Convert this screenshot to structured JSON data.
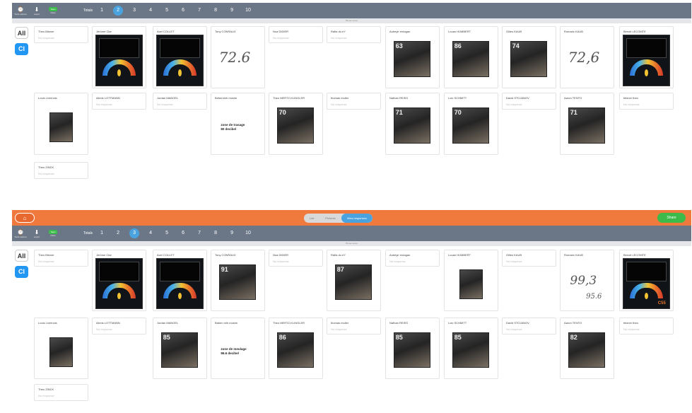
{
  "sidebar": {
    "all_label": "All",
    "cl_label": "Cl"
  },
  "toolbar": {
    "tools": [
      {
        "icon": "⌚",
        "label": "Tools options"
      },
      {
        "icon": "⬇",
        "label": "export"
      },
      {
        "badge": "Team",
        "label": "share"
      }
    ],
    "totals_label": "Totals",
    "pages": [
      "1",
      "2",
      "3",
      "4",
      "5",
      "6",
      "7",
      "8",
      "9",
      "10"
    ]
  },
  "panel1": {
    "active_page": "2",
    "substrip": "59 sec score",
    "cards": [
      {
        "name": "Theo Bitzner",
        "resp": "No response"
      },
      {
        "name": "Jérôme Clar"
      },
      {
        "name": "Axel COLLET"
      },
      {
        "name": "Tony CONRAUX",
        "hand": "72.6"
      },
      {
        "name": "Noa DIDIER",
        "resp": "No response"
      },
      {
        "name": "Rafia du eY",
        "resp": "No response"
      },
      {
        "name": "Aubeyir erdogan",
        "photo": "63"
      },
      {
        "name": "Louan HUMBERT",
        "photo": "86"
      },
      {
        "name": "Gilles KAUB",
        "photo": "74"
      },
      {
        "name": "Romaric KAUB",
        "hand": "72,6"
      },
      {
        "name": "Benoit LECOMTE"
      },
      {
        "name": "Louis Livernois"
      },
      {
        "name": "Alexis LOTTMANN",
        "resp": "No response"
      },
      {
        "name": "Jordan MANGEL",
        "resp": "No response"
      },
      {
        "name": "Bebenrinh mosim",
        "note1": "zone de trasage",
        "note2": "80 decibel"
      },
      {
        "name": "Theo MERTZ-KLINGLER",
        "photo": "70"
      },
      {
        "name": "thomas muller",
        "resp": "No response"
      },
      {
        "name": "Nathan REISS",
        "photo": "71"
      },
      {
        "name": "Loic SCHMITT",
        "photo": "70"
      },
      {
        "name": "David STOJANOV",
        "resp": "No response"
      },
      {
        "name": "Aaron TENTO",
        "photo": "71"
      },
      {
        "name": "bitzner theo",
        "resp": "No response"
      },
      {
        "name": "Theo ZINCK",
        "resp": "No response"
      }
    ]
  },
  "panel2": {
    "home_label": "⌂",
    "segments": [
      "List",
      "Pictures",
      "View responses"
    ],
    "share_label": "Share",
    "active_page": "3",
    "substrip": "59 sec score",
    "cards": [
      {
        "name": "Theo Bitzner",
        "resp": "No response"
      },
      {
        "name": "Jérôme Clar"
      },
      {
        "name": "Axel COLLET"
      },
      {
        "name": "Tony CONRAUX",
        "photo": "91"
      },
      {
        "name": "Noa DIDIER",
        "resp": "No response"
      },
      {
        "name": "Rafia du eY",
        "photo": "87"
      },
      {
        "name": "Aubeyir erdogan",
        "resp": "No response"
      },
      {
        "name": "Louan HUMBERT"
      },
      {
        "name": "Gilles KAUB",
        "resp": "No response"
      },
      {
        "name": "Romaric KAUB",
        "hand1": "99,3",
        "hand2": "95.6"
      },
      {
        "name": "Benoit LECOMTE",
        "meter": "C55"
      },
      {
        "name": "Louis Livernois"
      },
      {
        "name": "Alexis LOTTMANN",
        "resp": "No response"
      },
      {
        "name": "Jordan MANGEL",
        "photo": "85"
      },
      {
        "name": "Baben mih mosim",
        "note1": "zone de meulage",
        "note2": "86.6 decibel"
      },
      {
        "name": "Theo MERTZ-KLINGLER",
        "photo": "86"
      },
      {
        "name": "thomas muller",
        "resp": "No response"
      },
      {
        "name": "Nathan REISS",
        "photo": "85"
      },
      {
        "name": "Loic SCHMITT",
        "photo": "85"
      },
      {
        "name": "David STOJANOV",
        "resp": "No response"
      },
      {
        "name": "Aaron TENTO",
        "photo": "82"
      },
      {
        "name": "bitzner theo",
        "resp": "No response"
      },
      {
        "name": "Theo ZINCK",
        "resp": "No response"
      }
    ]
  }
}
